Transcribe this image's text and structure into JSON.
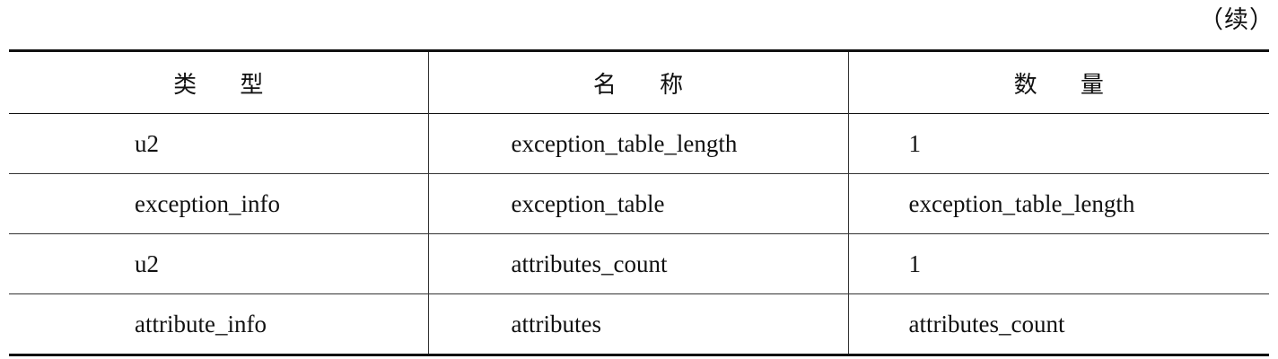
{
  "continued_label": "（续）",
  "table": {
    "headers": [
      "类 型",
      "名 称",
      "数 量"
    ],
    "rows": [
      [
        "u2",
        "exception_table_length",
        "1"
      ],
      [
        "exception_info",
        "exception_table",
        "exception_table_length"
      ],
      [
        "u2",
        "attributes_count",
        "1"
      ],
      [
        "attribute_info",
        "attributes",
        "attributes_count"
      ]
    ]
  }
}
